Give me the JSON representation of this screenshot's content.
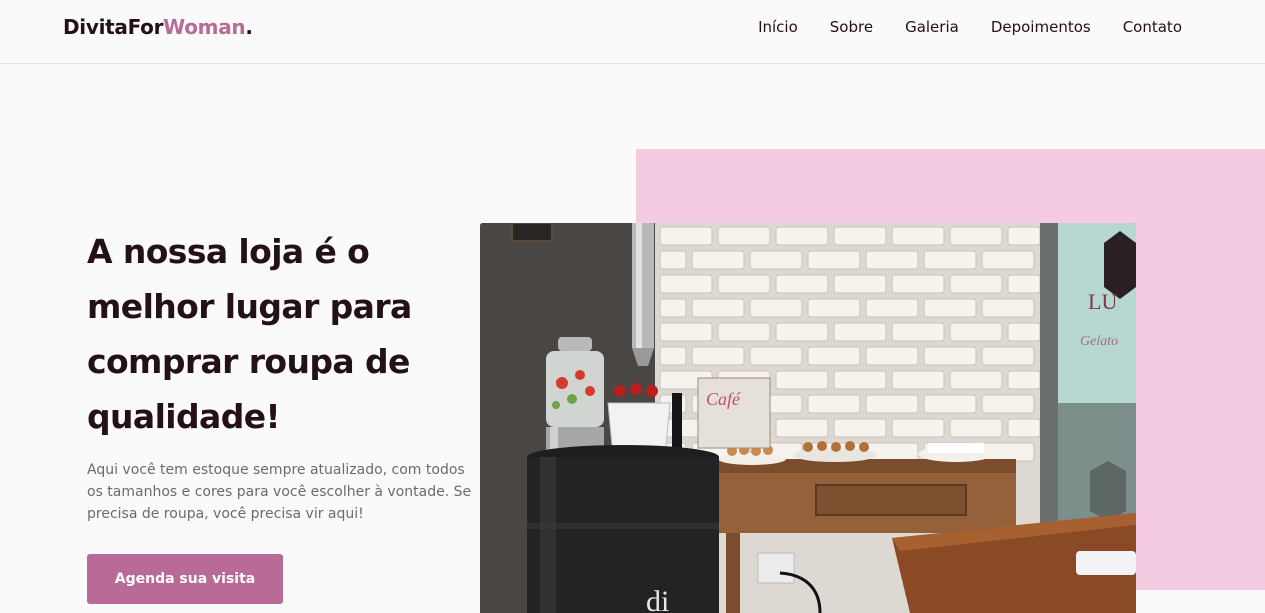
{
  "header": {
    "logo": {
      "part1": "DivitaFor",
      "part2": "Woman",
      "dot": "."
    },
    "nav": [
      "Início",
      "Sobre",
      "Galeria",
      "Depoimentos",
      "Contato"
    ]
  },
  "hero": {
    "title": "A nossa loja é o melhor lugar para comprar roupa de qualidade!",
    "description": "Aqui você tem estoque sempre atualizado, com todos os tamanhos e cores para você escolher à vontade. Se precisa de roupa, você precisa vir aqui!",
    "cta_label": "Agenda sua visita"
  },
  "colors": {
    "accent": "#b86b97",
    "accent_light": "#f4cbe0",
    "text_dark": "#241018",
    "text_muted": "#6b6b6b"
  }
}
